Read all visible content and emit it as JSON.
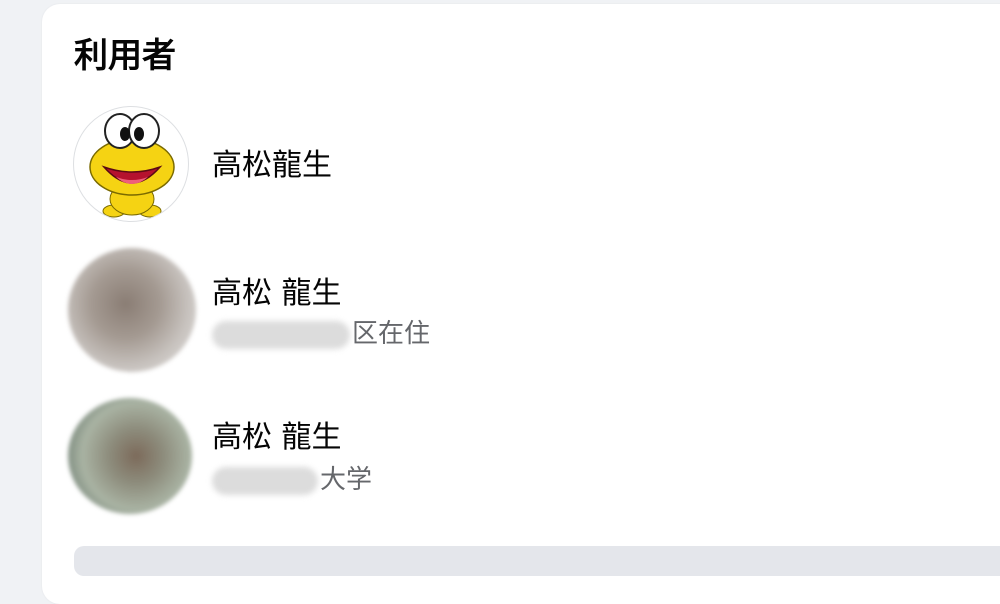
{
  "section": {
    "title": "利用者"
  },
  "users": [
    {
      "name": "高松龍生",
      "detail": ""
    },
    {
      "name": "高松 龍生",
      "detail": "区在住"
    },
    {
      "name": "高松 龍生",
      "detail": "大学"
    }
  ],
  "colors": {
    "background": "#f0f2f5",
    "card": "#ffffff",
    "name_text": "#050505",
    "secondary_text": "#65676b",
    "frog_yellow": "#f5d313"
  },
  "icons": {
    "avatar_1": "frog-character-avatar",
    "avatar_2": "blurred-photo-avatar",
    "avatar_3": "blurred-photo-avatar"
  }
}
